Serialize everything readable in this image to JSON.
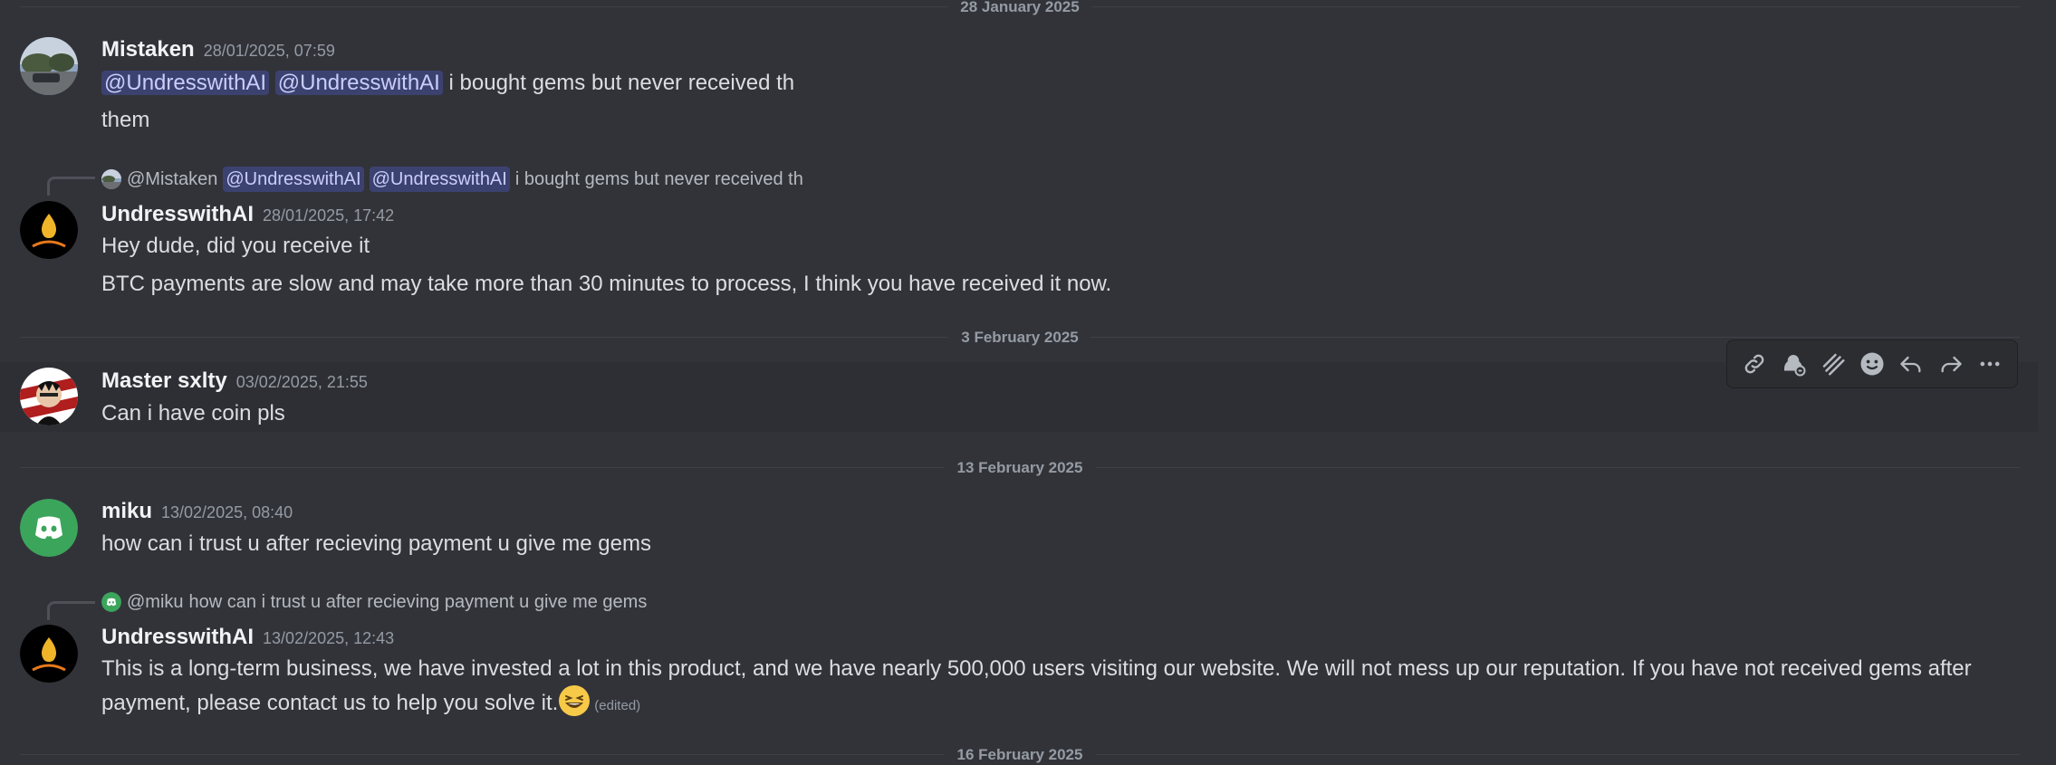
{
  "dividers": [
    "28 January 2025",
    "3 February 2025",
    "13 February 2025",
    "16 February 2025"
  ],
  "messages": [
    {
      "author": "Mistaken",
      "timestamp": "28/01/2025, 07:59",
      "mentions": [
        "@UndresswithAI",
        "@UndresswithAI"
      ],
      "text": "i bought gems but never received th",
      "text2": "them"
    },
    {
      "reply": {
        "author": "@Mistaken",
        "mentions": [
          "@UndresswithAI",
          "@UndresswithAI"
        ],
        "text": "i bought gems but never received th"
      },
      "author": "UndresswithAI",
      "timestamp": "28/01/2025, 17:42",
      "text": "Hey dude, did you receive it",
      "text2": "BTC payments are slow and may take more than 30 minutes to process, I think you have received it now."
    },
    {
      "author": "Master sxlty",
      "timestamp": "03/02/2025, 21:55",
      "text": "Can i have coin pls"
    },
    {
      "author": "miku",
      "timestamp": "13/02/2025, 08:40",
      "text": "how can i trust u after recieving payment u give me gems"
    },
    {
      "reply": {
        "author": "@miku",
        "text": "how can i trust u after recieving payment u give me gems"
      },
      "author": "UndresswithAI",
      "timestamp": "13/02/2025, 12:43",
      "text": "This is a long-term business, we have invested a lot in this product, and we have nearly 500,000 users visiting our website. We will not mess up our reputation. If you have not received gems after payment, please contact us to help you solve it.",
      "edited": "(edited)"
    }
  ],
  "toolbar": {
    "icons": [
      "link-icon",
      "app-bot-icon",
      "super-reaction-icon",
      "add-reaction-icon",
      "reply-icon",
      "forward-icon",
      "more-icon"
    ]
  },
  "colors": {
    "background": "#323339",
    "mention_bg": "#3c4270",
    "mention_text": "#c9cdfb",
    "discord_green": "#3ba55c",
    "avatar_yellow": "#f0b429"
  }
}
